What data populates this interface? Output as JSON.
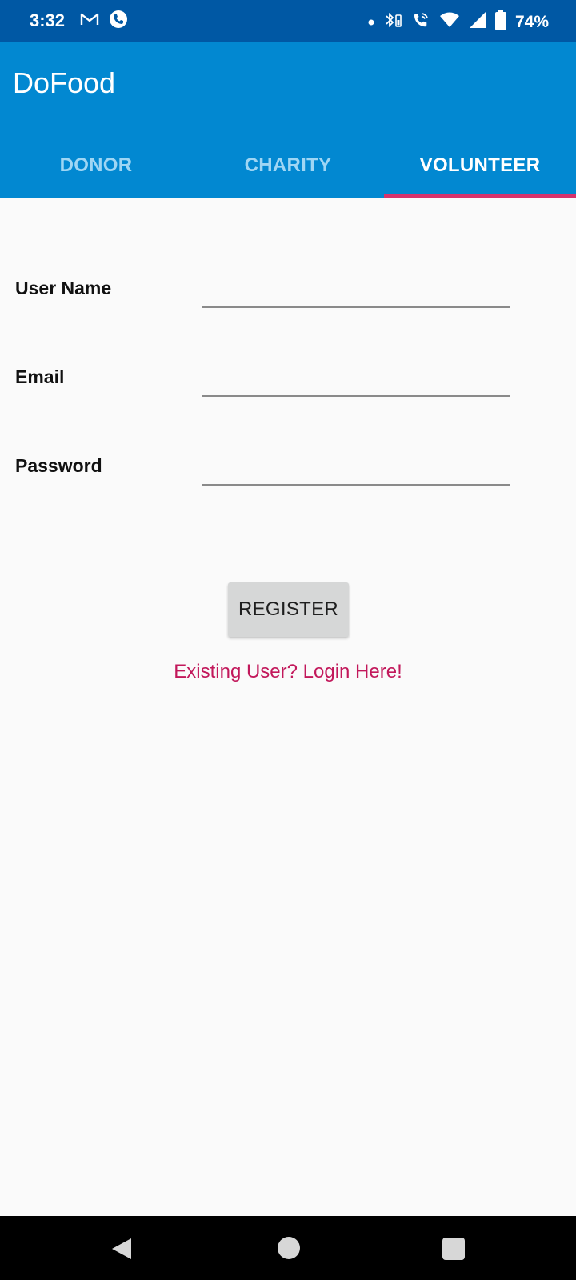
{
  "status_bar": {
    "time": "3:32",
    "left_icons": [
      "gmail-icon",
      "phone-call-icon"
    ],
    "right_icons": [
      "notification-dot-icon",
      "bluetooth-battery-icon",
      "wifi-calling-icon",
      "wifi-icon",
      "cellular-signal-icon",
      "battery-icon"
    ],
    "battery_percent": "74%"
  },
  "app_bar": {
    "title": "DoFood"
  },
  "tabs": [
    {
      "label": "DONOR",
      "selected": false
    },
    {
      "label": "CHARITY",
      "selected": false
    },
    {
      "label": "VOLUNTEER",
      "selected": true
    }
  ],
  "form": {
    "user_name_label": "User Name",
    "user_name_value": "",
    "email_label": "Email",
    "email_value": "",
    "password_label": "Password",
    "password_value": "",
    "register_label": "REGISTER",
    "login_link": "Existing User? Login Here!"
  },
  "nav_bar": {
    "buttons": [
      "back-icon",
      "home-icon",
      "recents-icon"
    ]
  },
  "colors": {
    "status_bar": "#0058a4",
    "primary": "#0288d1",
    "accent": "#d6336c",
    "link": "#c2185b",
    "background": "#fafafa"
  }
}
